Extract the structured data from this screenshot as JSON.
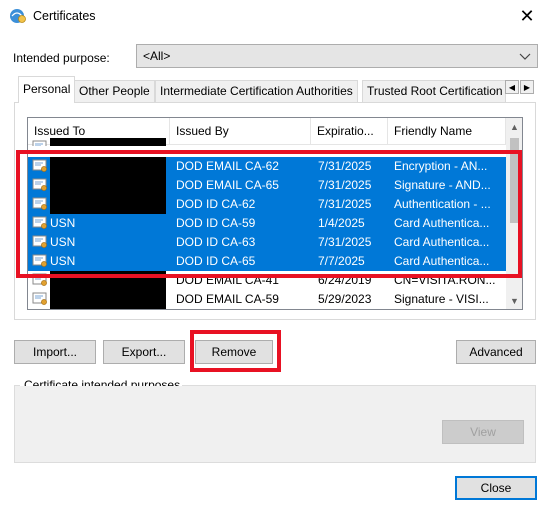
{
  "window": {
    "title": "Certificates",
    "close_glyph": "✕"
  },
  "purpose": {
    "label": "Intended purpose:",
    "value": "<All>"
  },
  "tabs": [
    {
      "label": "Personal"
    },
    {
      "label": "Other People"
    },
    {
      "label": "Intermediate Certification Authorities"
    },
    {
      "label": "Trusted Root Certification"
    }
  ],
  "list": {
    "columns": [
      "Issued To",
      "Issued By",
      "Expiratio...",
      "Friendly Name"
    ],
    "rows": [
      {
        "issued_to": "",
        "issued_by": "",
        "expiration": "",
        "friendly": "",
        "selected": false,
        "redacted": true,
        "partial": true
      },
      {
        "issued_to": "",
        "issued_by": "DOD EMAIL CA-62",
        "expiration": "7/31/2025",
        "friendly": "Encryption - AN...",
        "selected": true,
        "redacted": true
      },
      {
        "issued_to": "",
        "issued_by": "DOD EMAIL CA-65",
        "expiration": "7/31/2025",
        "friendly": "Signature - AND...",
        "selected": true,
        "redacted": true
      },
      {
        "issued_to": "",
        "issued_by": "DOD ID CA-62",
        "expiration": "7/31/2025",
        "friendly": "Authentication - ...",
        "selected": true,
        "redacted": true
      },
      {
        "issued_to": "USN",
        "issued_by": "DOD ID CA-59",
        "expiration": "1/4/2025",
        "friendly": "Card Authentica...",
        "selected": true,
        "redacted": false
      },
      {
        "issued_to": "USN",
        "issued_by": "DOD ID CA-63",
        "expiration": "7/31/2025",
        "friendly": "Card Authentica...",
        "selected": true,
        "redacted": false
      },
      {
        "issued_to": "USN",
        "issued_by": "DOD ID CA-65",
        "expiration": "7/7/2025",
        "friendly": "Card Authentica...",
        "selected": true,
        "redacted": false
      },
      {
        "issued_to": "",
        "issued_by": "DOD EMAIL CA-41",
        "expiration": "6/24/2019",
        "friendly": "CN=VISITA.RON...",
        "selected": false,
        "redacted": true
      },
      {
        "issued_to": "",
        "issued_by": "DOD EMAIL CA-59",
        "expiration": "5/29/2023",
        "friendly": "Signature - VISI...",
        "selected": false,
        "redacted": true
      }
    ]
  },
  "buttons": {
    "import": "Import...",
    "export": "Export...",
    "remove": "Remove",
    "advanced": "Advanced",
    "view": "View",
    "close": "Close"
  },
  "purposes_group": {
    "title": "Certificate intended purposes"
  },
  "icons": {
    "window": "certificate-window-icon",
    "cert": "certificate-icon",
    "dropdown": "chevron-down-icon",
    "scroll_left": "scroll-left-icon",
    "scroll_right": "scroll-right-icon",
    "scroll_up": "scroll-up-icon",
    "scroll_down": "scroll-down-icon"
  },
  "colors": {
    "selection": "#0078d7",
    "highlight": "#e81123",
    "redaction": "#000000"
  }
}
